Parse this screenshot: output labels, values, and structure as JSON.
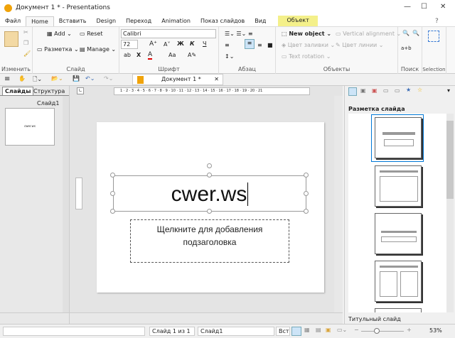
{
  "window": {
    "title": "Документ 1 * - Presentations",
    "minimize": "—",
    "maximize": "☐",
    "close": "✕"
  },
  "menu_tabs": [
    "Файл",
    "Home",
    "Вставить",
    "Design",
    "Переход",
    "Animation",
    "Показ слайдов",
    "Вид"
  ],
  "context_tab": "Объект",
  "ribbon": {
    "edit": {
      "label": "Изменить"
    },
    "slide": {
      "label": "Слайд",
      "add": "Add",
      "reset": "Reset",
      "layout": "Разметка",
      "manage": "Manage"
    },
    "font": {
      "label": "Шрифт",
      "name": "Calibri",
      "size": "72",
      "bold": "Ж",
      "italic": "К",
      "underline": "Ч"
    },
    "paragraph": {
      "label": "Абзац"
    },
    "objects": {
      "label": "Объекты",
      "new_object": "New object",
      "vertical_alignment": "Vertical alignment",
      "fill_color": "Цвет заливки",
      "line_color": "Цвет линии",
      "text_rotation": "Text rotation"
    },
    "search": {
      "label": "Поиск",
      "replace": "a+b"
    },
    "selection": {
      "label": "Selection"
    },
    "help": "?"
  },
  "document_tab": {
    "label": "Документ 1 *",
    "close": "✕"
  },
  "left_panel": {
    "tabs": [
      "Слайды",
      "Структура"
    ],
    "slide_label": "Слайд1",
    "thumb_text": "cwer.ws"
  },
  "slide": {
    "title": "cwer.ws",
    "subtitle_placeholder": "Щелкните для добавления подзаголовка"
  },
  "ruler": "1 · 2 · 3 · 4 · 5 · 6 · 7 · 8 · 9 · 10 · 11 · 12 · 13 · 14 · 15 · 16 · 17 · 18 · 19 · 20 · 21",
  "right_panel": {
    "heading": "Разметка слайда",
    "selected_layout": "Титульный слайд"
  },
  "status": {
    "slide_count": "Слайд 1 из 1",
    "slide_name": "Слайд1",
    "mode": "Вст",
    "zoom": "53%",
    "zoom_level": 53
  },
  "colors": {
    "accent": "#0078d7",
    "context_tab": "#f4f08a",
    "font_color": "#e00000"
  }
}
